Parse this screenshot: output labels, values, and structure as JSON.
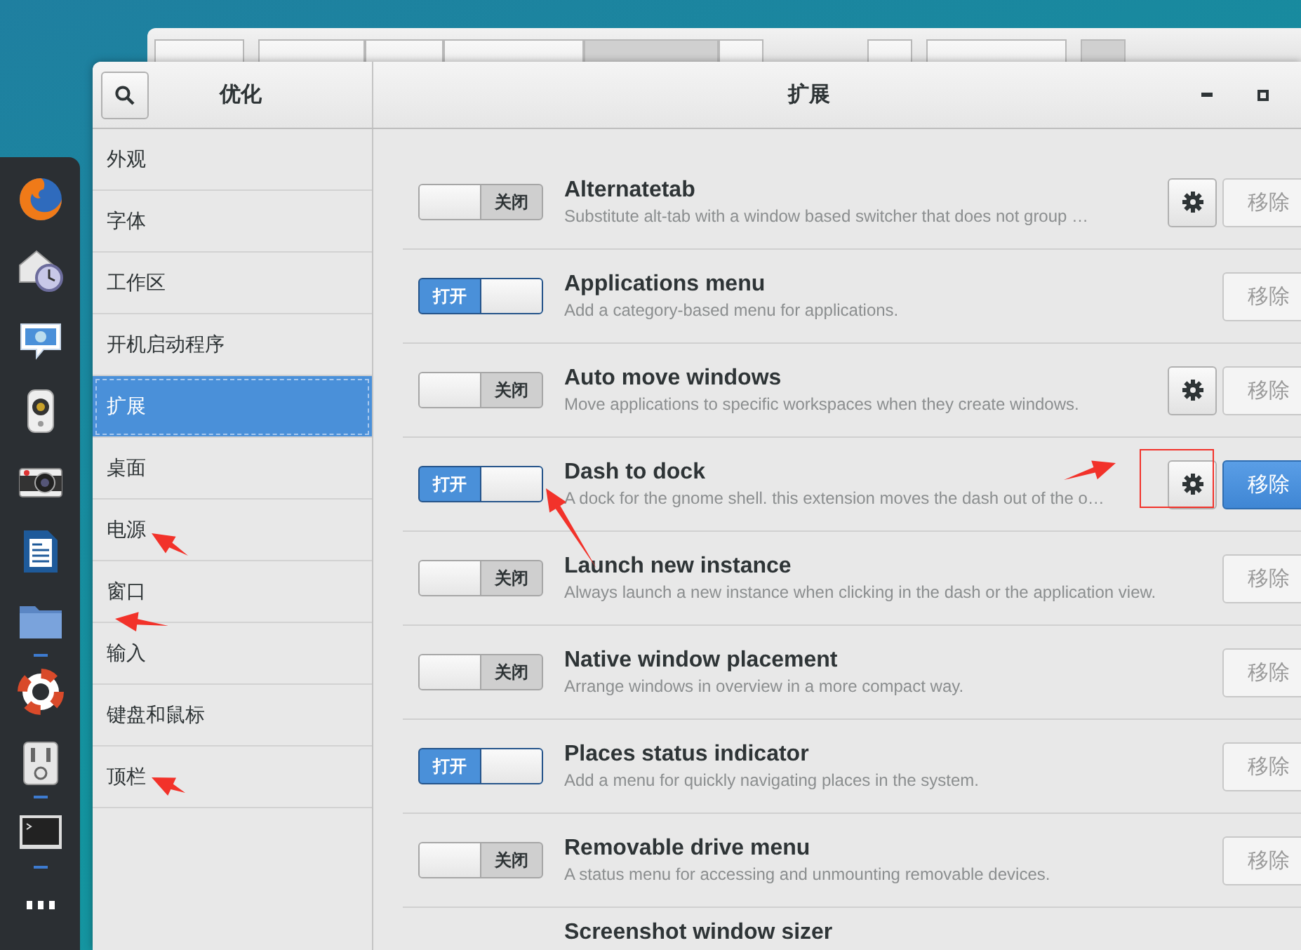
{
  "dock": {
    "apps": [
      {
        "kind": "browser",
        "running": false
      },
      {
        "kind": "mail",
        "running": false
      },
      {
        "kind": "chat",
        "running": false
      },
      {
        "kind": "speaker",
        "running": false
      },
      {
        "kind": "camera",
        "running": false
      },
      {
        "kind": "document",
        "running": false
      },
      {
        "kind": "folder",
        "running": true
      },
      {
        "kind": "help",
        "running": false
      },
      {
        "kind": "tweaks",
        "running": true
      },
      {
        "kind": "terminal",
        "running": true
      },
      {
        "kind": "grid",
        "running": false
      }
    ]
  },
  "window": {
    "sidebar_title": "优化",
    "title": "扩展"
  },
  "sidebar": {
    "items": [
      {
        "label": "外观",
        "selected": false
      },
      {
        "label": "字体",
        "selected": false
      },
      {
        "label": "工作区",
        "selected": false
      },
      {
        "label": "开机启动程序",
        "selected": false
      },
      {
        "label": "扩展",
        "selected": true
      },
      {
        "label": "桌面",
        "selected": false
      },
      {
        "label": "电源",
        "selected": false
      },
      {
        "label": "窗口",
        "selected": false
      },
      {
        "label": "输入",
        "selected": false
      },
      {
        "label": "键盘和鼠标",
        "selected": false
      },
      {
        "label": "顶栏",
        "selected": false
      }
    ]
  },
  "extensions": [
    {
      "name": "Alternatetab",
      "description": "Substitute alt-tab with a window based switcher that does not group …",
      "enabled": false,
      "switch_label": "关闭",
      "has_settings": true,
      "remove_label": "移除",
      "selected": false
    },
    {
      "name": "Applications menu",
      "description": "Add a category-based menu for applications.",
      "enabled": true,
      "switch_label": "打开",
      "has_settings": false,
      "remove_label": "移除",
      "selected": false
    },
    {
      "name": "Auto move windows",
      "description": "Move applications to specific workspaces when they create windows.",
      "enabled": false,
      "switch_label": "关闭",
      "has_settings": true,
      "remove_label": "移除",
      "selected": false
    },
    {
      "name": "Dash to dock",
      "description": "A dock for the gnome shell. this extension moves the dash out of the o…",
      "enabled": true,
      "switch_label": "打开",
      "has_settings": true,
      "remove_label": "移除",
      "selected": true
    },
    {
      "name": "Launch new instance",
      "description": "Always launch a new instance when clicking in the dash or the application view.",
      "enabled": false,
      "switch_label": "关闭",
      "has_settings": false,
      "remove_label": "移除",
      "selected": false
    },
    {
      "name": "Native window placement",
      "description": "Arrange windows in overview in a more compact way.",
      "enabled": false,
      "switch_label": "关闭",
      "has_settings": false,
      "remove_label": "移除",
      "selected": false
    },
    {
      "name": "Places status indicator",
      "description": "Add a menu for quickly navigating places in the system.",
      "enabled": true,
      "switch_label": "打开",
      "has_settings": false,
      "remove_label": "移除",
      "selected": false
    },
    {
      "name": "Removable drive menu",
      "description": "A status menu for accessing and unmounting removable devices.",
      "enabled": false,
      "switch_label": "关闭",
      "has_settings": false,
      "remove_label": "移除",
      "selected": false
    },
    {
      "name": "Screenshot window sizer",
      "kind": "partial"
    }
  ],
  "annotations": [
    {
      "kind": "arrow"
    },
    {
      "kind": "arrow"
    },
    {
      "kind": "arrow"
    },
    {
      "kind": "arrow"
    },
    {
      "kind": "arrow"
    },
    {
      "kind": "highlight"
    }
  ]
}
